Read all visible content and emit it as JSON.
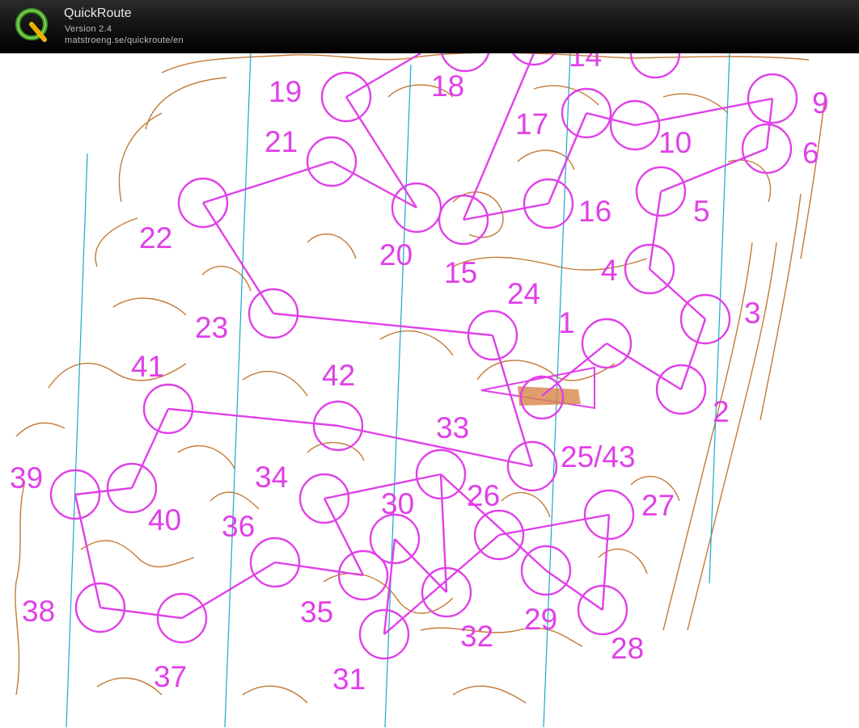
{
  "app": {
    "title": "QuickRoute",
    "version": "Version 2.4",
    "url": "matstroeng.se/quickroute/en"
  },
  "colors": {
    "titlebar": "#111111",
    "contour": "#c47a35",
    "course": "#e040e8",
    "magnetic_north_lines": "#1aa7cc",
    "start_triangle_fill": "#d7864a"
  },
  "icons": {
    "logo": "quickroute-q-logo"
  },
  "course": {
    "controls": [
      {
        "label": "1"
      },
      {
        "label": "2"
      },
      {
        "label": "3"
      },
      {
        "label": "4"
      },
      {
        "label": "5"
      },
      {
        "label": "6"
      },
      {
        "label": "9"
      },
      {
        "label": "10"
      },
      {
        "label": "14"
      },
      {
        "label": "15"
      },
      {
        "label": "16"
      },
      {
        "label": "17"
      },
      {
        "label": "18"
      },
      {
        "label": "19"
      },
      {
        "label": "20"
      },
      {
        "label": "21"
      },
      {
        "label": "22"
      },
      {
        "label": "23"
      },
      {
        "label": "24"
      },
      {
        "label": "25/43"
      },
      {
        "label": "26"
      },
      {
        "label": "27"
      },
      {
        "label": "28"
      },
      {
        "label": "29"
      },
      {
        "label": "30"
      },
      {
        "label": "31"
      },
      {
        "label": "32"
      },
      {
        "label": "33"
      },
      {
        "label": "34"
      },
      {
        "label": "35"
      },
      {
        "label": "36"
      },
      {
        "label": "37"
      },
      {
        "label": "38"
      },
      {
        "label": "39"
      },
      {
        "label": "40"
      },
      {
        "label": "41"
      },
      {
        "label": "42"
      }
    ]
  }
}
